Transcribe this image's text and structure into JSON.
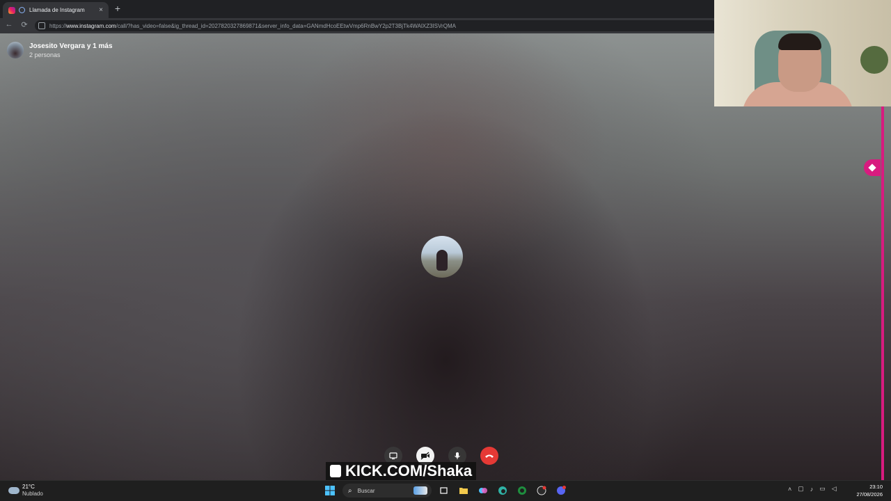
{
  "browser": {
    "tab_title": "Llamada de Instagram",
    "tab_close": "×",
    "new_tab": "+",
    "back": "←",
    "reload": "⟳",
    "url_prefix": "https://",
    "url_domain": "www.instagram.com",
    "url_rest": "/call/?has_video=false&ig_thread_id=2027820327869871&server_info_data=GANmdHcoEEtwVmp6RnBwY2p2T3BjTk4WAlXZ3ISVrQMA"
  },
  "call": {
    "title": "Josesito Vergara y 1 más",
    "subtitle": "2 personas",
    "controls": {
      "screen_share_icon": "screen-share-icon",
      "video_off_icon": "video-off-icon",
      "mic_icon": "microphone-icon",
      "end_call_icon": "end-call-icon"
    }
  },
  "overlay": {
    "watermark": "KICK.COM/Shaka"
  },
  "taskbar": {
    "temperature": "21°C",
    "weather": "Nublado",
    "search_placeholder": "Buscar",
    "time": "23:10",
    "date": "27/08/2026"
  }
}
